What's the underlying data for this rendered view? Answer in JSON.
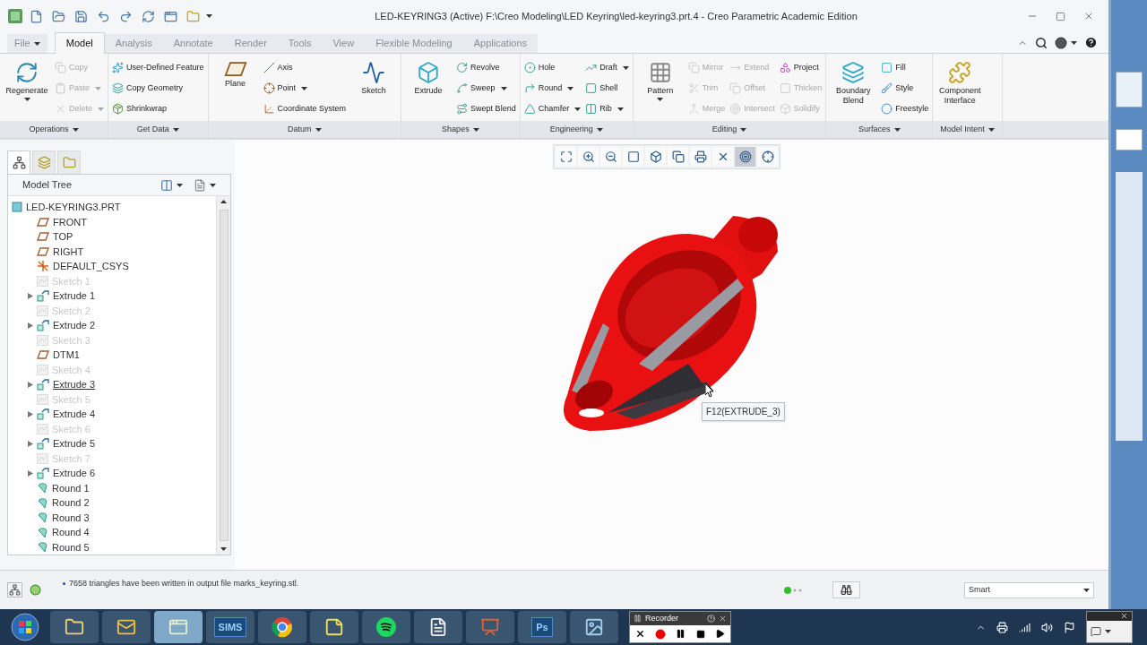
{
  "window": {
    "title": "LED-KEYRING3 (Active) F:\\Creo Modeling\\LED Keyring\\led-keyring3.prt.4 - Creo Parametric Academic Edition"
  },
  "tabs": [
    {
      "label": "File",
      "kind": "menu",
      "selected": false
    },
    {
      "label": "Model",
      "kind": "tab",
      "selected": true
    },
    {
      "label": "Analysis",
      "kind": "tab",
      "selected": false
    },
    {
      "label": "Annotate",
      "kind": "tab",
      "selected": false
    },
    {
      "label": "Render",
      "kind": "tab",
      "selected": false
    },
    {
      "label": "Tools",
      "kind": "tab",
      "selected": false
    },
    {
      "label": "View",
      "kind": "tab",
      "selected": false
    },
    {
      "label": "Flexible Modeling",
      "kind": "tab",
      "selected": false
    },
    {
      "label": "Applications",
      "kind": "tab",
      "selected": false
    }
  ],
  "ribbon": [
    {
      "label": "Operations",
      "columns": [
        [
          {
            "label": "Regenerate",
            "kind": "large",
            "disabled": false,
            "dropdown": true
          }
        ],
        [
          {
            "label": "Copy",
            "kind": "small",
            "disabled": true,
            "dropdown": false
          },
          {
            "label": "Paste",
            "kind": "small",
            "disabled": true,
            "dropdown": true
          },
          {
            "label": "Delete",
            "kind": "small",
            "disabled": true,
            "dropdown": true
          }
        ]
      ]
    },
    {
      "label": "Get Data",
      "columns": [
        [
          {
            "label": "User-Defined Feature",
            "kind": "small",
            "disabled": false,
            "dropdown": false
          },
          {
            "label": "Copy Geometry",
            "kind": "small",
            "disabled": false,
            "dropdown": false
          },
          {
            "label": "Shrinkwrap",
            "kind": "small",
            "disabled": false,
            "dropdown": false
          }
        ]
      ]
    },
    {
      "label": "Datum",
      "columns": [
        [
          {
            "label": "Plane",
            "kind": "large",
            "disabled": false,
            "dropdown": false
          }
        ],
        [
          {
            "label": "Axis",
            "kind": "small",
            "disabled": false,
            "dropdown": false
          },
          {
            "label": "Point",
            "kind": "small",
            "disabled": false,
            "dropdown": true
          },
          {
            "label": "Coordinate System",
            "kind": "small",
            "disabled": false,
            "dropdown": false
          }
        ],
        [
          {
            "label": "Sketch",
            "kind": "large",
            "disabled": false,
            "dropdown": false
          }
        ]
      ]
    },
    {
      "label": "Shapes",
      "columns": [
        [
          {
            "label": "Extrude",
            "kind": "large",
            "disabled": false,
            "dropdown": false
          }
        ],
        [
          {
            "label": "Revolve",
            "kind": "small",
            "disabled": false,
            "dropdown": false
          },
          {
            "label": "Sweep",
            "kind": "small",
            "disabled": false,
            "dropdown": true
          },
          {
            "label": "Swept Blend",
            "kind": "small",
            "disabled": false,
            "dropdown": false
          }
        ]
      ]
    },
    {
      "label": "Engineering",
      "columns": [
        [
          {
            "label": "Hole",
            "kind": "small",
            "disabled": false,
            "dropdown": false
          },
          {
            "label": "Round",
            "kind": "small",
            "disabled": false,
            "dropdown": true
          },
          {
            "label": "Chamfer",
            "kind": "small",
            "disabled": false,
            "dropdown": true
          }
        ],
        [
          {
            "label": "Draft",
            "kind": "small",
            "disabled": false,
            "dropdown": true
          },
          {
            "label": "Shell",
            "kind": "small",
            "disabled": false,
            "dropdown": false
          },
          {
            "label": "Rib",
            "kind": "small",
            "disabled": false,
            "dropdown": true
          }
        ]
      ]
    },
    {
      "label": "Editing",
      "columns": [
        [
          {
            "label": "Pattern",
            "kind": "large",
            "disabled": false,
            "dropdown": true
          }
        ],
        [
          {
            "label": "Mirror",
            "kind": "small",
            "disabled": true,
            "dropdown": false
          },
          {
            "label": "Trim",
            "kind": "small",
            "disabled": true,
            "dropdown": false
          },
          {
            "label": "Merge",
            "kind": "small",
            "disabled": true,
            "dropdown": false
          }
        ],
        [
          {
            "label": "Extend",
            "kind": "small",
            "disabled": true,
            "dropdown": false
          },
          {
            "label": "Offset",
            "kind": "small",
            "disabled": true,
            "dropdown": false
          },
          {
            "label": "Intersect",
            "kind": "small",
            "disabled": true,
            "dropdown": false
          }
        ],
        [
          {
            "label": "Project",
            "kind": "small",
            "disabled": false,
            "dropdown": false
          },
          {
            "label": "Thicken",
            "kind": "small",
            "disabled": true,
            "dropdown": false
          },
          {
            "label": "Solidify",
            "kind": "small",
            "disabled": true,
            "dropdown": false
          }
        ]
      ]
    },
    {
      "label": "Surfaces",
      "columns": [
        [
          {
            "label": "Boundary Blend",
            "kind": "large",
            "disabled": false,
            "dropdown": false
          }
        ],
        [
          {
            "label": "Fill",
            "kind": "small",
            "disabled": false,
            "dropdown": false
          },
          {
            "label": "Style",
            "kind": "small",
            "disabled": false,
            "dropdown": false
          },
          {
            "label": "Freestyle",
            "kind": "small",
            "disabled": false,
            "dropdown": false
          }
        ]
      ]
    },
    {
      "label": "Model Intent",
      "columns": [
        [
          {
            "label": "Component Interface",
            "kind": "large",
            "disabled": false,
            "dropdown": false
          }
        ]
      ]
    }
  ],
  "navigator_tabs": [
    {
      "kind": "tree",
      "selected": true
    },
    {
      "kind": "layers",
      "selected": false
    },
    {
      "kind": "folder",
      "selected": false
    }
  ],
  "model_tree": {
    "title": "Model Tree",
    "root": {
      "label": "LED-KEYRING3.PRT",
      "kind": "part",
      "children": [
        {
          "label": "FRONT",
          "kind": "plane",
          "hidden": false,
          "highlighted": false
        },
        {
          "label": "TOP",
          "kind": "plane",
          "hidden": false,
          "highlighted": false
        },
        {
          "label": "RIGHT",
          "kind": "plane",
          "hidden": false,
          "highlighted": false
        },
        {
          "label": "DEFAULT_CSYS",
          "kind": "csys",
          "hidden": false,
          "highlighted": false
        },
        {
          "label": "Sketch 1",
          "kind": "sketch",
          "hidden": true,
          "highlighted": false
        },
        {
          "label": "Extrude 1",
          "kind": "extrude",
          "hidden": false,
          "highlighted": false,
          "expanded": false
        },
        {
          "label": "Sketch 2",
          "kind": "sketch",
          "hidden": true,
          "highlighted": false
        },
        {
          "label": "Extrude 2",
          "kind": "extrude",
          "hidden": false,
          "highlighted": false,
          "expanded": false
        },
        {
          "label": "Sketch 3",
          "kind": "sketch",
          "hidden": true,
          "highlighted": false
        },
        {
          "label": "DTM1",
          "kind": "plane",
          "hidden": false,
          "highlighted": false
        },
        {
          "label": "Sketch 4",
          "kind": "sketch",
          "hidden": true,
          "highlighted": false
        },
        {
          "label": "Extrude 3",
          "kind": "extrude",
          "hidden": false,
          "highlighted": true,
          "expanded": false
        },
        {
          "label": "Sketch 5",
          "kind": "sketch",
          "hidden": true,
          "highlighted": false
        },
        {
          "label": "Extrude 4",
          "kind": "extrude",
          "hidden": false,
          "highlighted": false,
          "expanded": false
        },
        {
          "label": "Sketch 6",
          "kind": "sketch",
          "hidden": true,
          "highlighted": false
        },
        {
          "label": "Extrude 5",
          "kind": "extrude",
          "hidden": false,
          "highlighted": false,
          "expanded": false
        },
        {
          "label": "Sketch 7",
          "kind": "sketch",
          "hidden": true,
          "highlighted": false
        },
        {
          "label": "Extrude 6",
          "kind": "extrude",
          "hidden": false,
          "highlighted": false,
          "expanded": false
        },
        {
          "label": "Round 1",
          "kind": "round",
          "hidden": false,
          "highlighted": false
        },
        {
          "label": "Round 2",
          "kind": "round",
          "hidden": false,
          "highlighted": false
        },
        {
          "label": "Round 3",
          "kind": "round",
          "hidden": false,
          "highlighted": false
        },
        {
          "label": "Round 4",
          "kind": "round",
          "hidden": false,
          "highlighted": false
        },
        {
          "label": "Round 5",
          "kind": "round",
          "hidden": false,
          "highlighted": false
        }
      ]
    }
  },
  "view_toolbar": [
    {
      "kind": "refit",
      "selected": false
    },
    {
      "kind": "zoom-in",
      "selected": false
    },
    {
      "kind": "zoom-out",
      "selected": false
    },
    {
      "kind": "repaint",
      "selected": false
    },
    {
      "kind": "orientation",
      "selected": false
    },
    {
      "kind": "saved-views",
      "selected": false
    },
    {
      "kind": "display-style",
      "selected": false
    },
    {
      "kind": "datum-display",
      "selected": false
    },
    {
      "kind": "spin-center",
      "selected": true
    },
    {
      "kind": "annotation",
      "selected": false
    }
  ],
  "viewport": {
    "tooltip": "F12(EXTRUDE_3)"
  },
  "status_bar": {
    "message": "7658 triangles have been written in output file marks_keyring.stl.",
    "filter": "Smart"
  },
  "taskbar": {
    "items": [
      {
        "kind": "start",
        "selected": false
      },
      {
        "kind": "folder",
        "selected": false
      },
      {
        "kind": "mail",
        "selected": false
      },
      {
        "kind": "window",
        "selected": true
      },
      {
        "kind": "text",
        "label": "SIMS",
        "selected": false
      },
      {
        "kind": "browser",
        "selected": false
      },
      {
        "kind": "notes",
        "selected": false
      },
      {
        "kind": "music",
        "selected": false
      },
      {
        "kind": "document",
        "selected": false
      },
      {
        "kind": "slides",
        "selected": false
      },
      {
        "kind": "text",
        "label": "Ps",
        "selected": false
      },
      {
        "kind": "photos",
        "selected": false
      }
    ],
    "recorder": {
      "title": "Recorder"
    }
  }
}
